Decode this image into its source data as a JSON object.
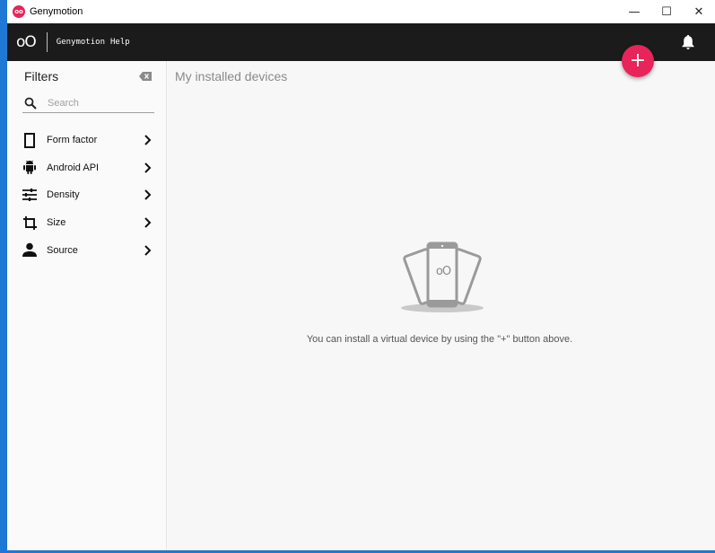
{
  "window": {
    "title": "Genymotion",
    "logo_text": "oo",
    "controls": {
      "minimize": "—",
      "maximize": "☐",
      "close": "✕"
    }
  },
  "toolbar": {
    "brand": "oO",
    "menu": [
      "Genymotion",
      "Help"
    ],
    "notification_icon": "bell-icon"
  },
  "fab": {
    "label": "+",
    "color": "#e8245a"
  },
  "sidebar": {
    "title": "Filters",
    "search_placeholder": "Search",
    "items": [
      {
        "label": "Form factor",
        "icon": "phone-outline-icon"
      },
      {
        "label": "Android API",
        "icon": "android-icon"
      },
      {
        "label": "Density",
        "icon": "tune-icon"
      },
      {
        "label": "Size",
        "icon": "crop-icon"
      },
      {
        "label": "Source",
        "icon": "person-icon"
      }
    ]
  },
  "main": {
    "heading": "My installed devices",
    "empty_message": "You can install a virtual device by using the \"+\" button above.",
    "illustration_text": "oO"
  },
  "colors": {
    "accent": "#e8245a",
    "toolbar_bg": "#1b1b1b",
    "desktop": "#1e78d4"
  }
}
